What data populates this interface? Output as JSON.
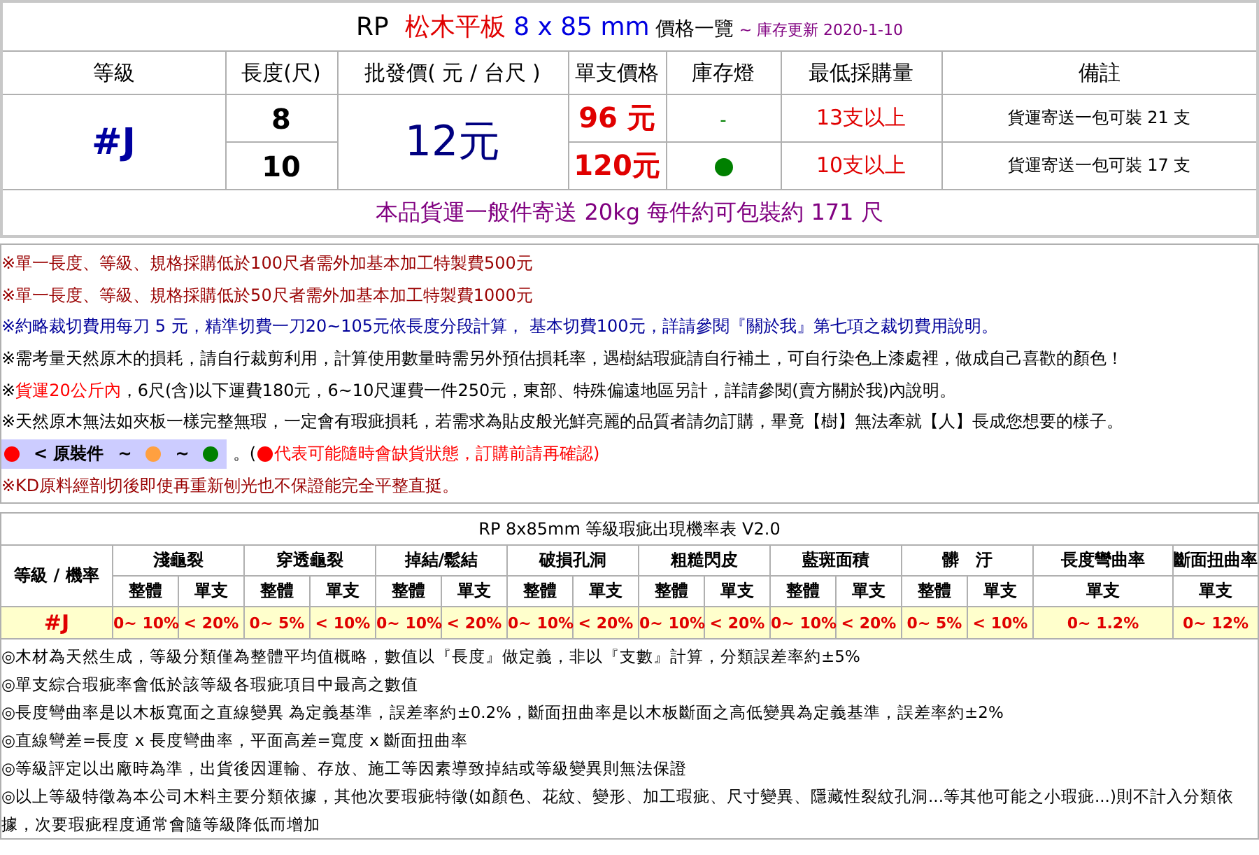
{
  "title": {
    "prefix": "RP",
    "product": "松木平板",
    "size": "8 x 85 mm",
    "suffix": "價格一覽",
    "update": "~ 庫存更新 2020-1-10"
  },
  "price_table": {
    "columns": [
      "等級",
      "長度(尺)",
      "批發價( 元 / 台尺 )",
      "單支價格",
      "庫存燈",
      "最低採購量",
      "備註"
    ],
    "grade": "#J",
    "wholesale": "12元",
    "rows": [
      {
        "length": "8",
        "unit_price": "96 元",
        "stock": {
          "kind": "text",
          "text": "-"
        },
        "minimum": "13支以上",
        "note": "貨運寄送一包可裝 21 支"
      },
      {
        "length": "10",
        "unit_price": "120元",
        "stock": {
          "kind": "dot",
          "color": "#008000"
        },
        "minimum": "10支以上",
        "note": "貨運寄送一包可裝 17 支"
      }
    ],
    "shipping": "本品貨運一般件寄送 20kg 每件約可包裝約 171 尺"
  },
  "notices": [
    {
      "kind": "text",
      "parts": [
        {
          "color": "#990000",
          "text": "※單一長度、等級、規格採購低於100尺者需外加基本加工特製費500元"
        }
      ]
    },
    {
      "kind": "text",
      "parts": [
        {
          "color": "#990000",
          "text": "※單一長度、等級、規格採購低於50尺者需外加基本加工特製費1000元"
        }
      ]
    },
    {
      "kind": "text",
      "parts": [
        {
          "color": "#000099",
          "text": "※約略裁切費用每刀 5 元，精準切費一刀20~105元依長度分段計算， 基本切費100元，詳請參閱『關於我』第七項之裁切費用說明。"
        }
      ]
    },
    {
      "kind": "text",
      "parts": [
        {
          "color": "#000000",
          "text": "※需考量天然原木的損耗，請自行裁剪利用，計算使用數量時需另外預估損耗率，遇樹結瑕疵請自行補土，可自行染色上漆處裡，做成自己喜歡的顏色！"
        }
      ]
    },
    {
      "kind": "text",
      "parts": [
        {
          "color": "#000000",
          "text": "※"
        },
        {
          "color": "#ff0000",
          "text": "貨運20公斤內"
        },
        {
          "color": "#000000",
          "text": "，6尺(含)以下運費180元，6~10尺運費一件250元，東部、特殊偏遠地區另計，詳請參閱(賣方關於我)內說明。"
        }
      ]
    },
    {
      "kind": "text",
      "parts": [
        {
          "color": "#000000",
          "text": "※天然原木無法如夾板一樣完整無瑕，一定會有瑕疵損耗，若需求為貼皮般光鮮亮麗的品質者請勿訂購，畢竟【樹】無法牽就【人】長成您想要的樣子。"
        }
      ]
    },
    {
      "kind": "legend",
      "items": [
        {
          "kind": "dot",
          "color": "#ff0000"
        },
        {
          "kind": "label",
          "text": "< 原裝件"
        },
        {
          "kind": "label",
          "text": "~"
        },
        {
          "kind": "dot",
          "color": "#ffa040"
        },
        {
          "kind": "label",
          "text": "~"
        },
        {
          "kind": "dot",
          "color": "#008000"
        }
      ],
      "separator": "。(",
      "note": {
        "color": "#ff0000",
        "text": "代表可能隨時會缺貨狀態，訂購前請再確認)"
      }
    },
    {
      "kind": "text",
      "parts": [
        {
          "color": "#990000",
          "text": "※KD原料經剖切後即使再重新刨光也不保證能完全平整直挺。"
        }
      ]
    }
  ],
  "defect_table": {
    "title": "RP 8x85mm  等級瑕疵出現機率表 V2.0",
    "corner": "等級 / 機率",
    "categories": [
      {
        "name": "淺龜裂",
        "subs": [
          "整體",
          "單支"
        ]
      },
      {
        "name": "穿透龜裂",
        "subs": [
          "整體",
          "單支"
        ]
      },
      {
        "name": "掉結/鬆結",
        "subs": [
          "整體",
          "單支"
        ]
      },
      {
        "name": "破損孔洞",
        "subs": [
          "整體",
          "單支"
        ]
      },
      {
        "name": "粗糙閃皮",
        "subs": [
          "整體",
          "單支"
        ]
      },
      {
        "name": "藍斑面積",
        "subs": [
          "整體",
          "單支"
        ]
      },
      {
        "name": "髒　汙",
        "subs": [
          "整體",
          "單支"
        ]
      },
      {
        "name": "長度彎曲率",
        "subs": [
          "單支"
        ]
      },
      {
        "name": "斷面扭曲率",
        "subs": [
          "單支"
        ]
      }
    ],
    "grade": "#J",
    "values": [
      "0~ 10%",
      "< 20%",
      "0~ 5%",
      "< 10%",
      "0~ 10%",
      "< 20%",
      "0~ 10%",
      "< 20%",
      "0~ 10%",
      "< 20%",
      "0~ 10%",
      "< 20%",
      "0~ 5%",
      "< 10%",
      "0~ 1.2%",
      "0~ 12%"
    ]
  },
  "footnotes": [
    "◎木材為天然生成，等級分類僅為整體平均值概略，數值以『長度』做定義，非以『支數』計算，分類誤差率約±5%",
    "◎單支綜合瑕疵率會低於該等級各瑕疵項目中最高之數值",
    "◎長度彎曲率是以木板寬面之直線變異 為定義基準，誤差率約±0.2%，斷面扭曲率是以木板斷面之高低變異為定義基準，誤差率約±2%",
    "◎直線彎差=長度 x 長度彎曲率，平面高差=寬度 x 斷面扭曲率",
    "◎等級評定以出廠時為準，出貨後因運輸、存放、施工等因素導致掉結或等級變異則無法保證",
    "◎以上等級特徵為本公司木料主要分類依據，其他次要瑕疵特徵(如顏色、花紋、變形、加工瑕疵、尺寸變異、隱藏性裂紋孔洞...等其他可能之小瑕疵...)則不計入分類依據，次要瑕疵程度通常會隨等級降低而增加"
  ]
}
